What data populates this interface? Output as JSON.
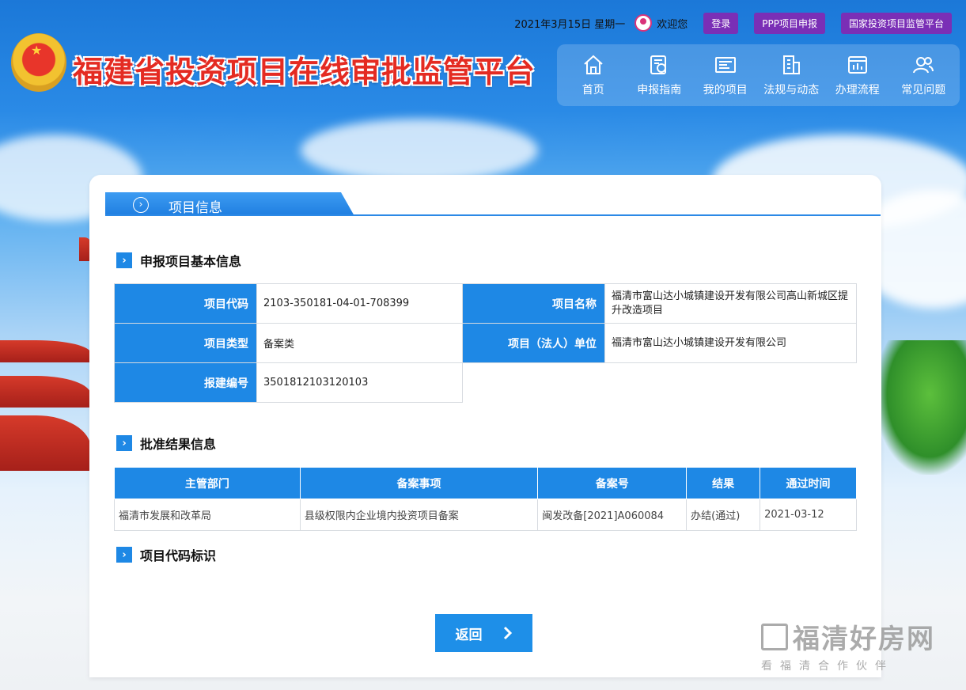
{
  "site_title": "福建省投资项目在线审批监管平台",
  "topbar": {
    "date": "2021年3月15日 星期一",
    "welcome": "欢迎您",
    "buttons": [
      "登录",
      "PPP项目申报",
      "国家投资项目监管平台"
    ]
  },
  "nav": [
    {
      "label": "首页",
      "icon": "home-icon"
    },
    {
      "label": "申报指南",
      "icon": "guide-icon"
    },
    {
      "label": "我的项目",
      "icon": "project-icon"
    },
    {
      "label": "法规与动态",
      "icon": "building-icon"
    },
    {
      "label": "办理流程",
      "icon": "process-icon"
    },
    {
      "label": "常见问题",
      "icon": "users-icon"
    }
  ],
  "card": {
    "tab_title": "项目信息",
    "sections": {
      "basic": "申报项目基本信息",
      "approval": "批准结果信息",
      "code": "项目代码标识"
    },
    "basic_info": {
      "code_label": "项目代码",
      "code_value": "2103-350181-04-01-708399",
      "name_label": "项目名称",
      "name_value": "福清市富山达小城镇建设开发有限公司高山新城区提升改造项目",
      "type_label": "项目类型",
      "type_value": "备案类",
      "unit_label": "项目（法人）单位",
      "unit_value": "福清市富山达小城镇建设开发有限公司",
      "report_label": "报建编号",
      "report_value": "3501812103120103"
    },
    "approval_table": {
      "headers": [
        "主管部门",
        "备案事项",
        "备案号",
        "结果",
        "通过时间"
      ],
      "rows": [
        [
          "福清市发展和改革局",
          "县级权限内企业境内投资项目备案",
          "闽发改备[2021]A060084",
          "办结(通过)",
          "2021-03-12"
        ]
      ]
    },
    "back_label": "返回"
  },
  "watermark": {
    "main": "福清好房网",
    "sub": "看福清合作伙伴"
  },
  "colors": {
    "primary": "#1e88e5",
    "title_red": "#e42b22",
    "top_button": "#7a2fb6"
  }
}
